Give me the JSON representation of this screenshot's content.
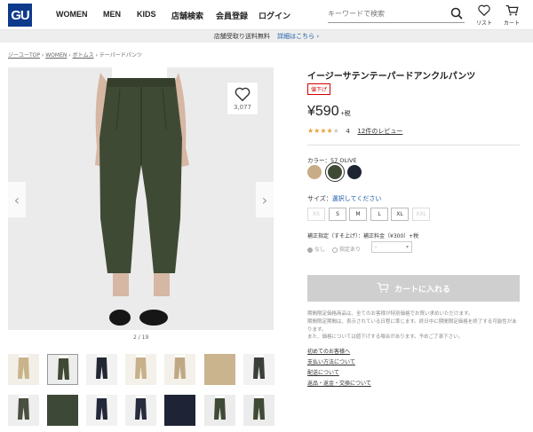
{
  "header": {
    "logo": "GU",
    "nav": [
      "WOMEN",
      "MEN",
      "KIDS",
      "店舗検索",
      "会員登録",
      "ログイン"
    ],
    "search_placeholder": "キーワードで検索",
    "icons": [
      {
        "name": "heart-icon",
        "label": "リスト"
      },
      {
        "name": "cart-icon",
        "label": "カート"
      }
    ]
  },
  "notice": {
    "text": "店舗受取り送料無料",
    "link": "詳細はこちら ›"
  },
  "breadcrumb": [
    "ジーユーTOP",
    "WOMEN",
    "ボトムス",
    "テーパードパンツ"
  ],
  "breadcrumb_sep": " › ",
  "gallery": {
    "favorite_count": "3,077",
    "image_counter": "2 / 19",
    "thumbs": [
      {
        "bg": "#f2efe9",
        "pant": "#c9b48a"
      },
      {
        "bg": "#ececec",
        "pant": "#3f4a34",
        "selected": true
      },
      {
        "bg": "#f2f2f2",
        "pant": "#222733"
      },
      {
        "bg": "#f4f1ea",
        "pant": "#c7b08a"
      },
      {
        "bg": "#f4f1ea",
        "pant": "#bfa985"
      },
      {
        "bg": "#c9b48d",
        "pant": "#c9b48d",
        "fabric": true
      },
      {
        "bg": "#f2f2f2",
        "pant": "#3a3f3a"
      },
      {
        "bg": "#eeeeee",
        "pant": "#4a5040"
      },
      {
        "bg": "#3d4836",
        "pant": "#3d4836",
        "fabric": true
      },
      {
        "bg": "#f2f2f2",
        "pant": "#23283a"
      },
      {
        "bg": "#f0f0f0",
        "pant": "#262b3d"
      },
      {
        "bg": "#1e2436",
        "pant": "#1e2436",
        "fabric": true
      },
      {
        "bg": "#ececec",
        "pant": "#3e4a36"
      },
      {
        "bg": "#ececec",
        "pant": "#3f4a35"
      }
    ]
  },
  "product": {
    "title": "イージーサテンテーパードアンクルパンツ",
    "badge": "値下げ",
    "price": "¥590",
    "tax": "+税",
    "rating": 4,
    "review_count": "4",
    "review_link": "12件のレビュー",
    "color_label": "カラー：57 OLIVE",
    "colors": [
      {
        "name": "beige",
        "hex": "#c8ac85"
      },
      {
        "name": "olive",
        "hex": "#3f4a34",
        "selected": true
      },
      {
        "name": "navy",
        "hex": "#1f2433"
      }
    ],
    "size_label": "サイズ：",
    "size_selected": "選択してください",
    "sizes": [
      {
        "label": "XS",
        "disabled": true
      },
      {
        "label": "S"
      },
      {
        "label": "M"
      },
      {
        "label": "L"
      },
      {
        "label": "XL"
      },
      {
        "label": "XXL",
        "disabled": true
      }
    ],
    "alter_label": "補正指定（すそ上げ）：補正料金（¥300）+税",
    "alter_options": [
      "なし",
      "指定あり"
    ],
    "alter_select": "-",
    "cart_button": "カートに入れる",
    "notes": [
      "期間限定価格商品は、全てのお客様が特別価格でお買い求めいただけます。",
      "期間限定期間は、表示されている日程に準じます。終日中に期間限定価格を終了する可能性があります。",
      "また、価格については値下げする場合があります。予めご了承下さい。"
    ],
    "links": [
      "初めてのお客様へ",
      "支払い方法について",
      "配送について",
      "返品・返金・交換について"
    ]
  }
}
